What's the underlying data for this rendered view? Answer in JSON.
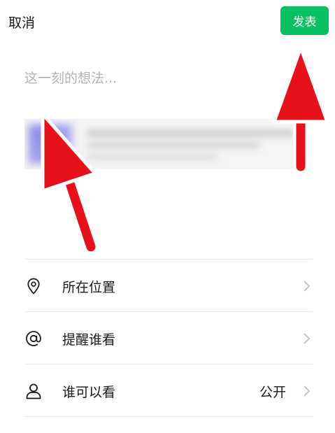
{
  "header": {
    "cancel_label": "取消",
    "publish_label": "发表"
  },
  "compose": {
    "placeholder": "这一刻的想法...",
    "value": ""
  },
  "options": [
    {
      "label": "所在位置",
      "icon": "location-pin-icon",
      "value": ""
    },
    {
      "label": "提醒谁看",
      "icon": "at-sign-icon",
      "value": ""
    },
    {
      "label": "谁可以看",
      "icon": "person-icon",
      "value": "公开"
    }
  ],
  "colors": {
    "publish_button": "#07c160",
    "annotation_arrow": "#e8101a",
    "placeholder": "#b3b3b3",
    "chevron": "#c7c7c7"
  }
}
